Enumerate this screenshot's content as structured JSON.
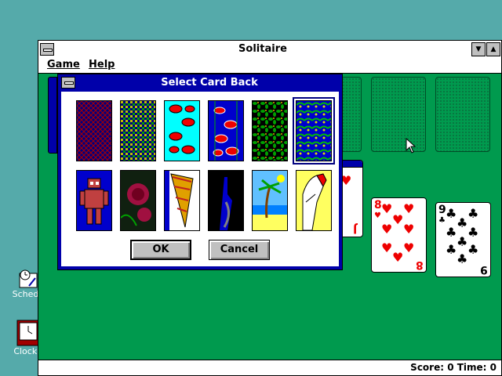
{
  "desktop": {
    "icons": [
      {
        "label": "Schedu"
      },
      {
        "label": "Clock - "
      }
    ]
  },
  "window": {
    "title": "Solitaire",
    "menu": [
      "Game",
      "Help"
    ],
    "status": "Score: 0 Time: 0"
  },
  "tableau": {
    "card1": {
      "rank": "8",
      "suit": "♥"
    },
    "card2": {
      "rank": "9",
      "suit": "♣"
    },
    "partial_left": {
      "rank": "6"
    },
    "partial_mid": {
      "rank": "J"
    }
  },
  "dialog": {
    "title": "Select Card Back",
    "ok_label": "OK",
    "cancel_label": "Cancel",
    "backs": [
      "crosshatch",
      "weave",
      "fish",
      "fish-dark",
      "leaves",
      "vines",
      "robot",
      "roses",
      "shell",
      "castle",
      "palm-beach",
      "hand"
    ],
    "selected_index": 5
  },
  "colors": {
    "felt": "#009a4e",
    "desktop": "#55aaaa",
    "titlebar_active": "#0000aa"
  }
}
